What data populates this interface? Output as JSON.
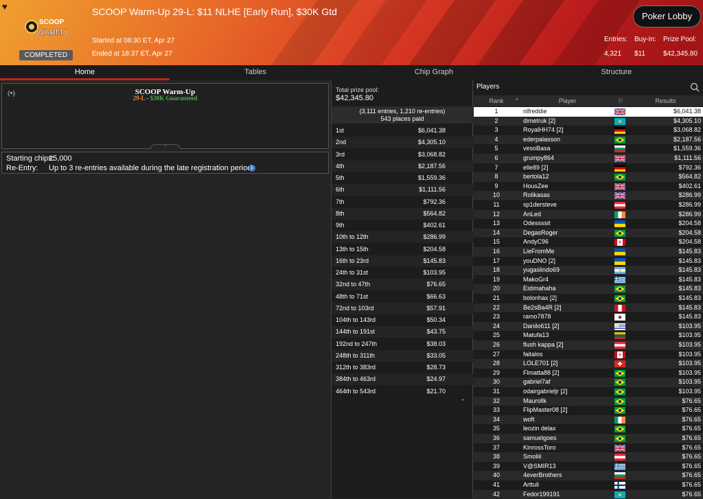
{
  "header": {
    "title": "SCOOP Warm-Up 29-L: $11 NLHE [Early Run], $30K Gtd",
    "logo_text": "SCOOP WARM UP",
    "status": "COMPLETED",
    "started": "Started at 08:30 ET, Apr 27",
    "ended": "Ended at 18:37 ET, Apr 27",
    "lobby_button": "Poker Lobby",
    "entries_label": "Entries:",
    "entries_value": "4,321",
    "buyin_label": "Buy-In:",
    "buyin_value": "$11",
    "prizepool_label": "Prize Pool:",
    "prizepool_value": "$42,345.80"
  },
  "tabs": [
    "Home",
    "Tables",
    "Chip Graph",
    "Structure"
  ],
  "banner": {
    "title": "SCOOP Warm-Up",
    "event": "29-L",
    "sep": " - ",
    "guarantee": "$30K Guaranteed"
  },
  "info": {
    "chips_label": "Starting chips:",
    "chips_value": "25,000",
    "reentry_label": "Re-Entry:",
    "reentry_value": "Up to 3 re-entries available during the late registration period."
  },
  "prize": {
    "total_label": "Total prize pool:",
    "total_value": "$42,345.80",
    "entries_line": "(3,111 entries, 1,210 re-entries)",
    "places_line": "543 places paid",
    "rows": [
      [
        "1st",
        "$6,041.38"
      ],
      [
        "2nd",
        "$4,305.10"
      ],
      [
        "3rd",
        "$3,068.82"
      ],
      [
        "4th",
        "$2,187.56"
      ],
      [
        "5th",
        "$1,559.36"
      ],
      [
        "6th",
        "$1,111.56"
      ],
      [
        "7th",
        "$792.36"
      ],
      [
        "8th",
        "$564.82"
      ],
      [
        "9th",
        "$402.61"
      ],
      [
        "10th to 12th",
        "$286.99"
      ],
      [
        "13th to 15th",
        "$204.58"
      ],
      [
        "16th to 23rd",
        "$145.83"
      ],
      [
        "24th to 31st",
        "$103.95"
      ],
      [
        "32nd to 47th",
        "$76.65"
      ],
      [
        "48th to 71st",
        "$66.63"
      ],
      [
        "72nd to 103rd",
        "$57.91"
      ],
      [
        "104th to 143rd",
        "$50.34"
      ],
      [
        "144th to 191st",
        "$43.75"
      ],
      [
        "192nd to 247th",
        "$38.03"
      ],
      [
        "248th to 311th",
        "$33.05"
      ],
      [
        "312th to 383rd",
        "$28.73"
      ],
      [
        "384th to 463rd",
        "$24.97"
      ],
      [
        "464th to 543rd",
        "$21.70"
      ]
    ]
  },
  "players": {
    "title": "Players",
    "col_rank": "Rank",
    "col_player": "Player",
    "col_results": "Results",
    "rows": [
      [
        "1",
        "nlfreddie",
        "uk",
        "$6,041.38"
      ],
      [
        "2",
        "dimetruk [2]",
        "kz",
        "$4,305.10"
      ],
      [
        "3",
        "RoyalHH74 [2]",
        "de",
        "$3,068.82"
      ],
      [
        "4",
        "ederpalasson",
        "br",
        "$2,187.56"
      ],
      [
        "5",
        "vesoBasa",
        "bg",
        "$1,559.36"
      ],
      [
        "6",
        "grumpy864",
        "uk",
        "$1,111.56"
      ],
      [
        "7",
        "elle89 [2]",
        "de",
        "$792.36"
      ],
      [
        "8",
        "bertola12",
        "br",
        "$564.82"
      ],
      [
        "9",
        "HousZee",
        "uk",
        "$402.61"
      ],
      [
        "10",
        "Rolikasas",
        "uk",
        "$286.99"
      ],
      [
        "11",
        "sp1dersteve",
        "at",
        "$286.99"
      ],
      [
        "12",
        "AnLed",
        "ie",
        "$286.99"
      ],
      [
        "13",
        "Odessssit",
        "ua",
        "$204.58"
      ],
      [
        "14",
        "DegasRoger",
        "br",
        "$204.58"
      ],
      [
        "15",
        "AndyC96",
        "ca",
        "$204.58"
      ],
      [
        "16",
        "LieFromMe",
        "ua",
        "$145.83"
      ],
      [
        "17",
        "youDNO [2]",
        "ua",
        "$145.83"
      ],
      [
        "18",
        "yugaslindo69",
        "ar",
        "$145.83"
      ],
      [
        "19",
        "MakoGr4",
        "gr",
        "$145.83"
      ],
      [
        "20",
        "Estimahaha",
        "br",
        "$145.83"
      ],
      [
        "21",
        "bolonhax [2]",
        "br",
        "$145.83"
      ],
      [
        "22",
        "Be2sBa4R [2]",
        "pe",
        "$145.83"
      ],
      [
        "23",
        "ramo7878",
        "kr",
        "$145.83"
      ],
      [
        "24",
        "Danilo611 [2]",
        "uy",
        "$103.95"
      ],
      [
        "25",
        "Matufa13",
        "lt",
        "$103.95"
      ],
      [
        "26",
        "flush kappa [2]",
        "at",
        "$103.95"
      ],
      [
        "27",
        "faitalos",
        "ca",
        "$103.95"
      ],
      [
        "28",
        "LOLE701 [2]",
        "ch",
        "$103.95"
      ],
      [
        "29",
        "Flmatta88 [2]",
        "br",
        "$103.95"
      ],
      [
        "30",
        "gabriel7af",
        "br",
        "$103.95"
      ],
      [
        "31",
        "odairgabrieljr [2]",
        "br",
        "$103.95"
      ],
      [
        "32",
        "Maurollk",
        "br",
        "$76.65"
      ],
      [
        "33",
        "FlipMaster08 [2]",
        "br",
        "$76.65"
      ],
      [
        "34",
        "woft",
        "ie",
        "$76.65"
      ],
      [
        "35",
        "leozin delax",
        "br",
        "$76.65"
      ],
      [
        "36",
        "samuelgoes",
        "br",
        "$76.65"
      ],
      [
        "37",
        "KinrossToro",
        "uk",
        "$76.65"
      ],
      [
        "38",
        "Smoliii",
        "at",
        "$76.65"
      ],
      [
        "39",
        "V@SMIR13",
        "gr",
        "$76.65"
      ],
      [
        "40",
        "4everBrothers",
        "bg",
        "$76.65"
      ],
      [
        "41",
        "Arttuli",
        "fi",
        "$76.65"
      ],
      [
        "42",
        "Fedor199191",
        "kz",
        "$76.65"
      ]
    ]
  },
  "colors": {
    "accent": "#c8231e",
    "event_orange": "#f08a2c",
    "guarantee_green": "#4caf50"
  }
}
